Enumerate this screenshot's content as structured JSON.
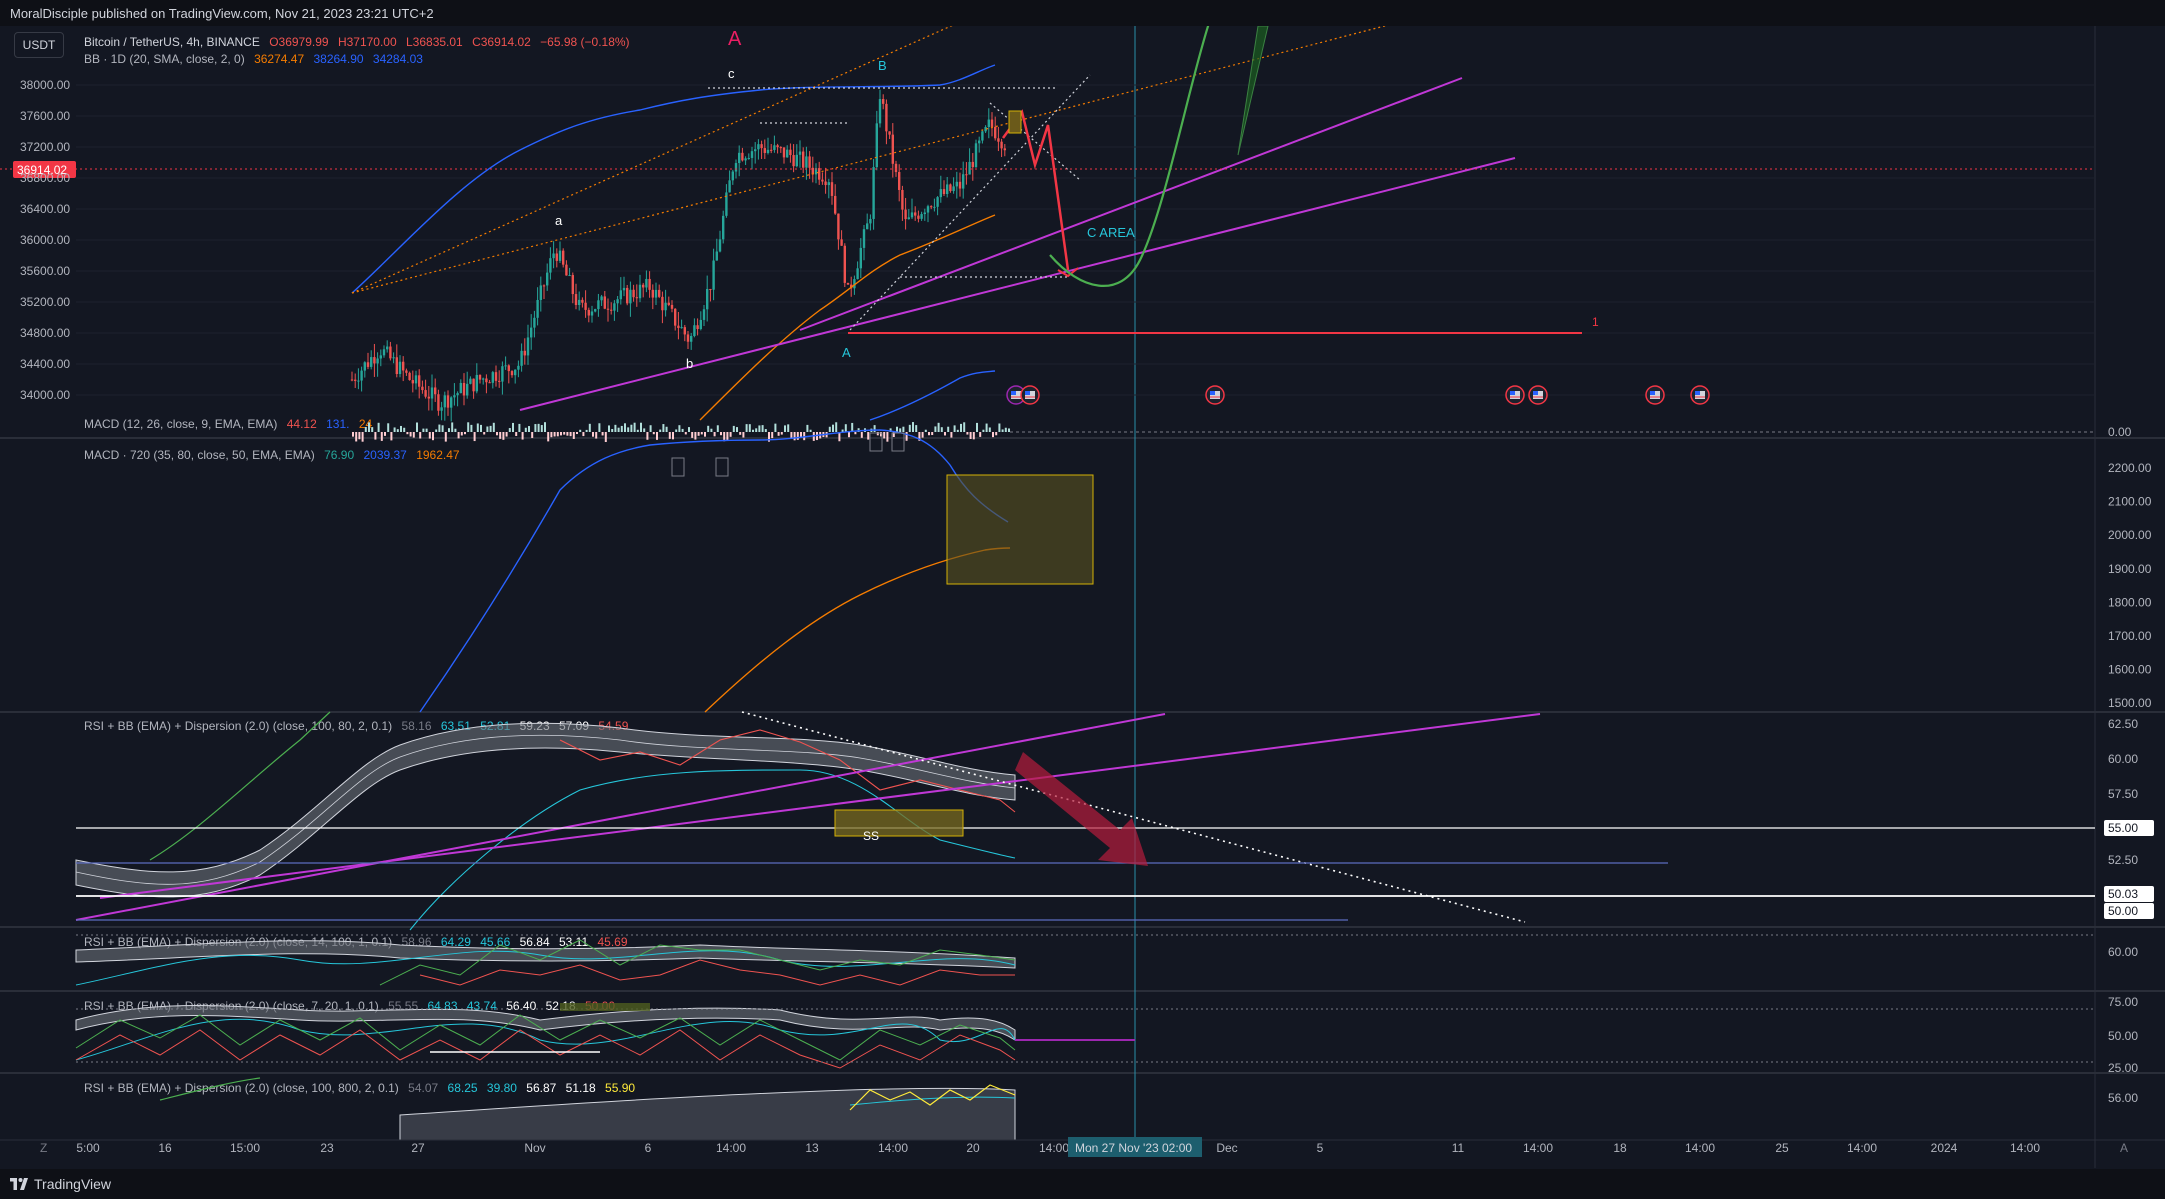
{
  "header": {
    "published": "MoralDisciple published on TradingView.com, Nov 21, 2023 23:21 UTC+2"
  },
  "symbol_button": "USDT",
  "main_legend": {
    "title": "Bitcoin / TetherUS, 4h, BINANCE",
    "o": "O36979.99",
    "h": "H37170.00",
    "l": "L36835.01",
    "c": "C36914.02",
    "change": "−65.98 (−0.18%)",
    "bb_label": "BB · 1D (20, SMA, close, 2, 0)",
    "bb_basis": "36274.47",
    "bb_upper": "38264.90",
    "bb_lower": "34284.03"
  },
  "macd1_legend": {
    "label": "MACD (12, 26, close, 9, EMA, EMA)",
    "v1": "44.12",
    "v2": "131.",
    "v3": "24"
  },
  "macd2_legend": {
    "label": "MACD · 720 (35, 80, close, 50, EMA, EMA)",
    "v1": "76.90",
    "v2": "2039.37",
    "v3": "1962.47"
  },
  "rsi1_legend": {
    "label": "RSI + BB (EMA) + Dispersion (2.0) (close, 100, 80, 2, 0.1)",
    "v0": "58.16",
    "v1": "63.51",
    "v2": "52.81",
    "v3": "59.23",
    "v4": "57.09",
    "v5": "54.59"
  },
  "rsi2_legend": {
    "label": "RSI + BB (EMA) + Dispersion (2.0) (close, 14, 100, 1, 0.1)",
    "v0": "58.96",
    "v1": "64.29",
    "v2": "45.66",
    "v3": "56.84",
    "v4": "53.11",
    "v5": "45.69"
  },
  "rsi3_legend": {
    "label": "RSI + BB (EMA) + Dispersion (2.0) (close, 7, 20, 1, 0.1)",
    "v0": "55.55",
    "v1": "64.83",
    "v2": "43.74",
    "v3": "56.40",
    "v4": "52.18",
    "v5": "50.00"
  },
  "rsi4_legend": {
    "label": "RSI + BB (EMA) + Dispersion (2.0) (close, 100, 800, 2, 0.1)",
    "v0": "54.07",
    "v1": "68.25",
    "v2": "39.80",
    "v3": "56.87",
    "v4": "51.18",
    "v5": "55.90"
  },
  "annotations": {
    "wave_A_top": "A",
    "c_label": "c",
    "B_label": "B",
    "a_label": "a",
    "b_label": "b",
    "A_label": "A",
    "c_area": "C AREA",
    "one_label": "1",
    "ss_label": "SS"
  },
  "colors": {
    "bg": "#131722",
    "up": "#26a69a",
    "down": "#ef5350",
    "bb_upper": "#2962ff",
    "bb_basis": "#f57c00",
    "magenta": "#c038d6",
    "green_curve": "#4caf50",
    "red_line": "#f23645",
    "price_tag": "#f23645",
    "crosshair": "#2a8fa8"
  },
  "chart_data": [
    {
      "type": "candlestick",
      "pane": "price",
      "title": "Bitcoin / TetherUS, 4h, BINANCE",
      "y_ticks": [
        "38000.00",
        "37600.00",
        "37200.00",
        "36800.00",
        "36400.00",
        "36000.00",
        "35600.00",
        "35200.00",
        "34800.00",
        "34400.00",
        "34000.00"
      ],
      "ylim": [
        33800,
        38400
      ],
      "last_price": "36914.02",
      "levels": {
        "red_horizontal": 34800
      },
      "x_ticks": [
        "5:00",
        "16",
        "15:00",
        "23",
        "27",
        "Nov",
        "6",
        "14:00",
        "13",
        "14:00",
        "20",
        "14:00",
        "Mon 27 Nov '23  02:00",
        "Dec",
        "5",
        "11",
        "14:00",
        "18",
        "14:00",
        "25",
        "14:00",
        "2024",
        "14:00"
      ]
    },
    {
      "type": "line",
      "pane": "macd_12_26",
      "y_ticks": [
        "0.00"
      ]
    },
    {
      "type": "line",
      "pane": "macd_720",
      "y_ticks": [
        "2200.00",
        "2100.00",
        "2000.00",
        "1900.00",
        "1800.00",
        "1700.00",
        "1600.00",
        "1500.00"
      ],
      "ylim": [
        1480,
        2280
      ]
    },
    {
      "type": "line",
      "pane": "rsi_100_80",
      "y_ticks": [
        "62.50",
        "60.00",
        "57.50",
        "55.00",
        "52.50",
        "50.03",
        "50.00"
      ],
      "ylim": [
        48,
        63
      ]
    },
    {
      "type": "line",
      "pane": "rsi_14_100",
      "y_ticks": [
        "60.00"
      ]
    },
    {
      "type": "line",
      "pane": "rsi_7_20",
      "y_ticks": [
        "75.00",
        "50.00",
        "25.00"
      ]
    },
    {
      "type": "line",
      "pane": "rsi_100_800",
      "y_ticks": [
        "56.00"
      ]
    }
  ],
  "footer": {
    "brand": "TradingView"
  }
}
